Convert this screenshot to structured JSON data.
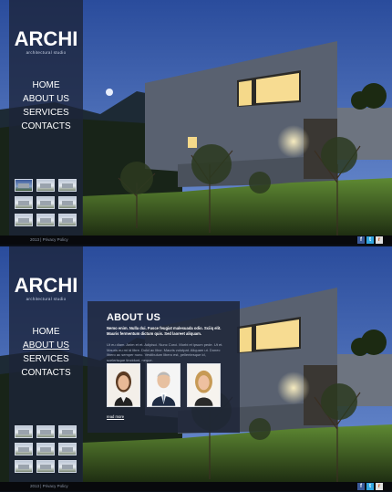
{
  "site": {
    "logo": "ARCHI",
    "tagline": "architectural studio"
  },
  "nav": {
    "items": [
      {
        "label": "HOME"
      },
      {
        "label": "ABOUT US"
      },
      {
        "label": "SERVICES"
      },
      {
        "label": "CONTACTS"
      }
    ]
  },
  "top_panel": {
    "active_nav": "none"
  },
  "bottom_panel": {
    "active_nav": "ABOUT US"
  },
  "about": {
    "heading": "ABOUT US",
    "lead": "Nemo enim. Nulla dui. Fusce feugiat malesuada odio. Sciiq elit. Mauris fermentum dictum quis. Sed laoreet aliquam.",
    "body": "Ut eu diam. Anim et et. Adipisci. Nunc Corci. Morbi et ipsum pede. Ut et. Mauris eu mi id libre. Dolci ac libcr. Mauris volutpat. Aliquam ut. Donec libero ac semper nunc. Vestibulum libero est, pellentesque id, scelerisque tincidunt, neque.",
    "read_more": "read more",
    "people": [
      {
        "name": "woman"
      },
      {
        "name": "man"
      },
      {
        "name": "woman-2"
      }
    ]
  },
  "footer": {
    "text": "2013 | Privacy Policy",
    "social": [
      {
        "name": "facebook-icon",
        "glyph": "f"
      },
      {
        "name": "twitter-icon",
        "glyph": "t"
      },
      {
        "name": "rss-icon",
        "glyph": "r"
      }
    ]
  },
  "colors": {
    "sky_top": "#2d4f9e",
    "sky_bottom": "#6d8fd1",
    "sidebar": "#1c2438",
    "house": "#5a6270",
    "window_glow": "#f5d98a",
    "grass": "#4f7a2b"
  }
}
